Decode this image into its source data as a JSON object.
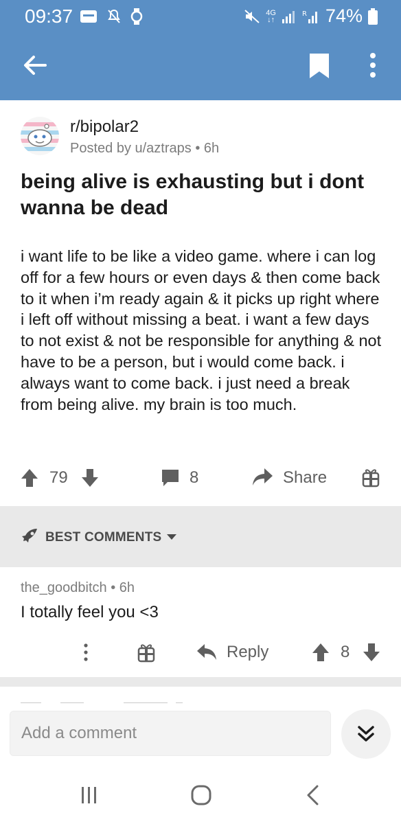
{
  "status_bar": {
    "time": "09:37",
    "network": "4G",
    "battery": "74%"
  },
  "app_bar": {
    "back_icon": "arrow-left-icon",
    "bookmark_icon": "bookmark-icon",
    "more_icon": "more-vertical-icon"
  },
  "post": {
    "subreddit": "r/bipolar2",
    "meta": "Posted by u/aztraps • 6h",
    "title": "being alive is exhausting but i dont wanna be dead",
    "body": "i want life to be like a video game. where i can log off for a few hours or even days & then come back to it when i’m ready again & it picks up right where i left off without missing a beat. i want a few days to not exist & not be responsible for anything & not have to be a person, but i would come back. i always want to come back. i just need a break from being alive. my brain is too much.",
    "score": "79",
    "comments_count": "8",
    "share_label": "Share"
  },
  "sort": {
    "label": "BEST COMMENTS"
  },
  "comment": {
    "author_meta": "the_goodbitch • 6h",
    "body": "I totally feel you <3",
    "reply_label": "Reply",
    "score": "8"
  },
  "composer": {
    "placeholder": "Add a comment"
  },
  "colors": {
    "app_bar": "#5a8fc5",
    "band": "#e9e9e9",
    "icon_gray": "#5f5f5f"
  }
}
